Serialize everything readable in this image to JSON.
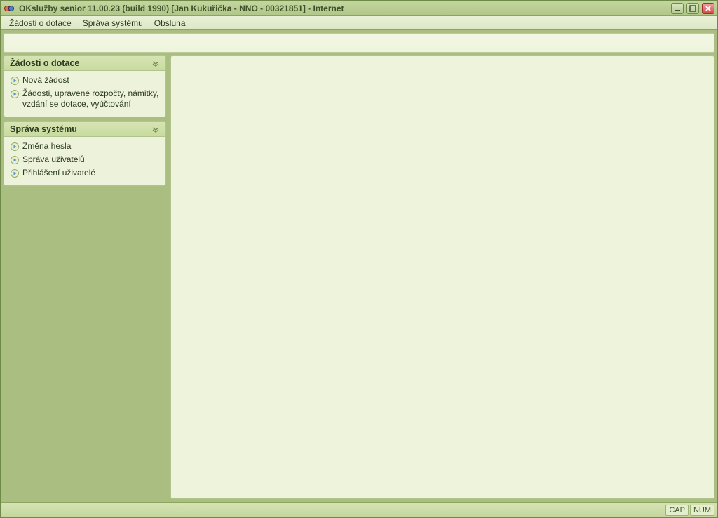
{
  "title": "OKslužby senior 11.00.23 (build 1990)  [Jan Kukuřička - NNO - 00321851] - Internet",
  "menubar": {
    "items": [
      {
        "label": "Žádosti o dotace",
        "underline_index": -1
      },
      {
        "label": "Správa systému",
        "underline_index": -1
      },
      {
        "label": "Obsluha",
        "underline_index": 0
      }
    ]
  },
  "sidebar": {
    "panels": [
      {
        "title": "Žádosti o dotace",
        "items": [
          {
            "label": "Nová žádost"
          },
          {
            "label": "Žádosti, upravené rozpočty, námitky, vzdání se dotace, vyúčtování"
          }
        ]
      },
      {
        "title": "Správa systému",
        "items": [
          {
            "label": "Změna hesla"
          },
          {
            "label": "Správa uživatelů"
          },
          {
            "label": "Přihlášení uživatelé"
          }
        ]
      }
    ]
  },
  "statusbar": {
    "cap": "CAP",
    "num": "NUM"
  }
}
